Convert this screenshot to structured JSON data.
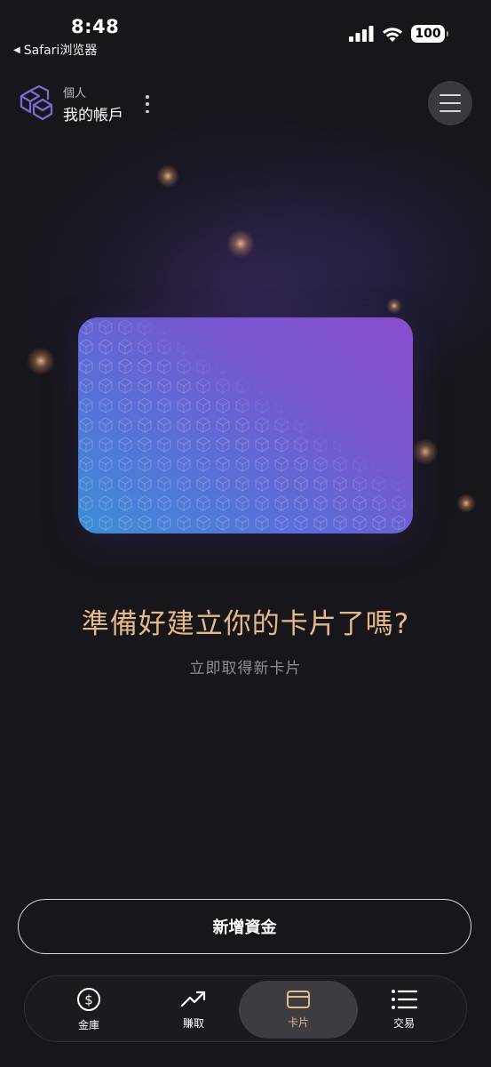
{
  "status_bar": {
    "time": "8:48",
    "back_label": "Safari浏览器",
    "battery": "100"
  },
  "header": {
    "account_type": "個人",
    "account_name": "我的帳戶"
  },
  "promo": {
    "headline": "準備好建立你的卡片了嗎?",
    "subline": "立即取得新卡片"
  },
  "actions": {
    "add_funds": "新增資金"
  },
  "tabs": [
    {
      "label": "金庫",
      "icon": "dollar-coin-icon"
    },
    {
      "label": "賺取",
      "icon": "trend-up-icon"
    },
    {
      "label": "卡片",
      "icon": "card-icon",
      "active": true
    },
    {
      "label": "交易",
      "icon": "list-icon"
    }
  ],
  "colors": {
    "accent": "#e5b98a",
    "background": "#17161b",
    "tab_active_bg": "#3d3c40"
  }
}
